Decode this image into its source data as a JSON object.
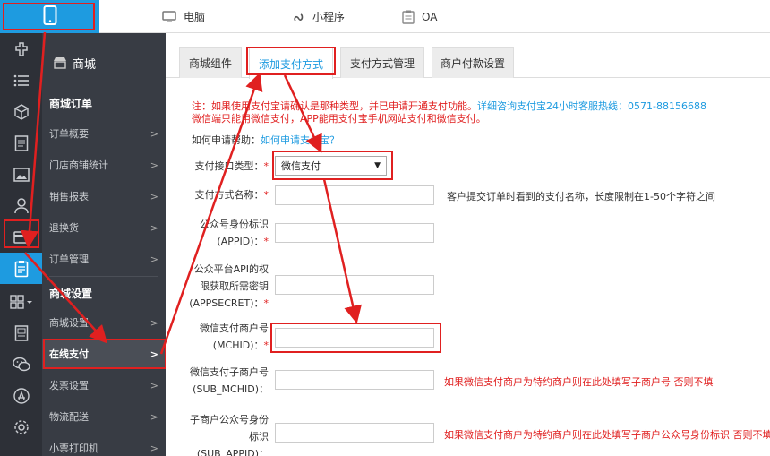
{
  "topbar": {
    "active_icon": "mobile-icon",
    "tabs": [
      {
        "label": "电脑",
        "icon": "monitor-icon"
      },
      {
        "label": "小程序",
        "icon": "mini-program-icon"
      },
      {
        "label": "OA",
        "icon": "clipboard-icon"
      }
    ]
  },
  "rail": {
    "items": [
      "plugin-icon",
      "list-icon",
      "box-icon",
      "document-icon",
      "image-icon",
      "user-icon",
      "card-icon",
      "order-clipboard-icon",
      "apps-icon",
      "report-icon",
      "wechat-icon",
      "app-store-icon",
      "settings-icon"
    ]
  },
  "sidebar": {
    "title": "商城",
    "section_orders": "商城订单",
    "section_settings": "商城设置",
    "items": [
      {
        "label": "订单概要"
      },
      {
        "label": "门店商铺统计"
      },
      {
        "label": "销售报表"
      },
      {
        "label": "退换货"
      },
      {
        "label": "订单管理"
      },
      {
        "label": "商城设置"
      },
      {
        "label": "在线支付"
      },
      {
        "label": "发票设置"
      },
      {
        "label": "物流配送"
      },
      {
        "label": "小票打印机"
      }
    ]
  },
  "tabs": [
    {
      "label": "商城组件"
    },
    {
      "label": "添加支付方式"
    },
    {
      "label": "支付方式管理"
    },
    {
      "label": "商户付款设置"
    }
  ],
  "notice": {
    "line1": "注：如果使用支付宝请确认是那种类型，并已申请开通支付功能。",
    "line1_link": "详细咨询支付宝24小时客服热线：0571-88156688",
    "line2": "微信端只能用微信支付，APP能用支付宝手机网站支付和微信支付。"
  },
  "help": {
    "prefix": "如何申请帮助：",
    "link": "如何申请支付宝？"
  },
  "form": {
    "interface_type_label": "支付接口类型：",
    "interface_type_value": "微信支付",
    "name_label": "支付方式名称：",
    "name_hint": "客户提交订单时看到的支付名称，长度限制在1-50个字符之间",
    "appid_label1": "公众号身份标识",
    "appid_label2": "(APPID)：",
    "secret_label1": "公众平台API的权",
    "secret_label2": "限获取所需密钥",
    "secret_label3": "(APPSECRET)：",
    "mchid_label1": "微信支付商户号",
    "mchid_label2": "(MCHID)：",
    "sub_mchid_label1": "微信支付子商户号",
    "sub_mchid_label2": "(SUB_MCHID)：",
    "sub_mchid_hint": "如果微信支付商户为特约商户则在此处填写子商户号 否则不填",
    "sub_appid_label1": "子商户公众号身份",
    "sub_appid_label2": "标识",
    "sub_appid_label3": "(SUB_APPID)：",
    "sub_appid_hint": "如果微信支付商户为特约商户则在此处填写子商户公众号身份标识 否则不填",
    "required_mark": "*"
  },
  "colors": {
    "accent": "#1e9be0",
    "highlight": "#e02020",
    "rail_bg": "#2d3037",
    "sidebar_bg": "#383c44"
  }
}
